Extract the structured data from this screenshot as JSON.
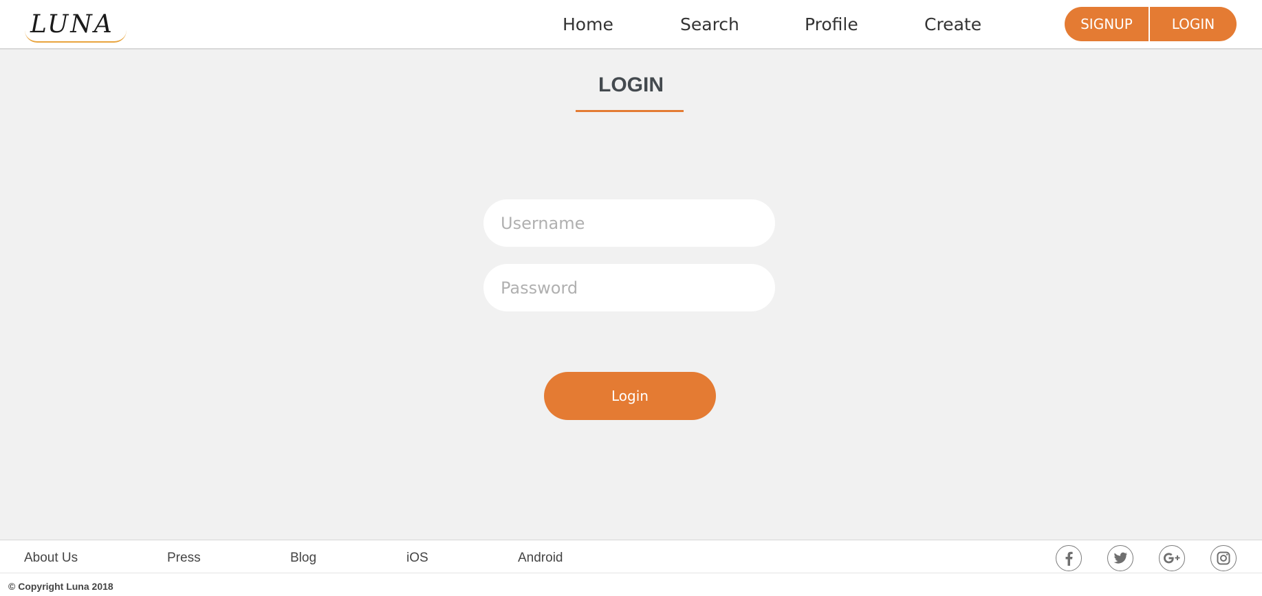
{
  "brand": {
    "logo_text": "LUNA",
    "accent_color": "#e47b33"
  },
  "nav": {
    "items": [
      {
        "label": "Home"
      },
      {
        "label": "Search"
      },
      {
        "label": "Profile"
      },
      {
        "label": "Create"
      }
    ]
  },
  "auth": {
    "signup_label": "SIGNUP",
    "login_label": "LOGIN"
  },
  "main": {
    "title": "LOGIN",
    "username_placeholder": "Username",
    "password_placeholder": "Password",
    "submit_label": "Login"
  },
  "footer": {
    "links": [
      {
        "label": "About Us"
      },
      {
        "label": "Press"
      },
      {
        "label": "Blog"
      },
      {
        "label": "iOS"
      },
      {
        "label": "Android"
      }
    ],
    "social_icons": [
      "facebook-icon",
      "twitter-icon",
      "google-plus-icon",
      "instagram-icon"
    ],
    "copyright": "© Copyright Luna 2018"
  }
}
